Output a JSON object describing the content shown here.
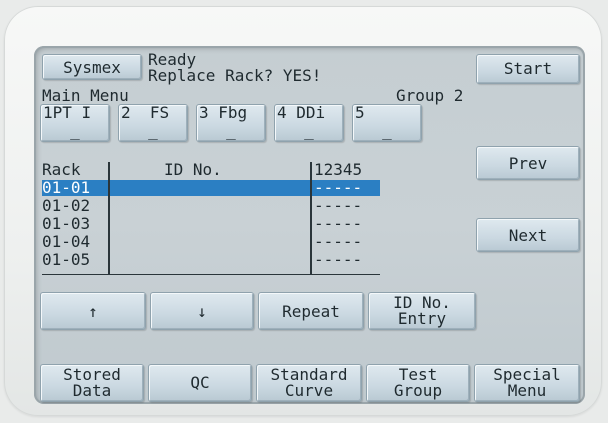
{
  "header": {
    "brand": "Sysmex",
    "status_line1": "Ready",
    "status_line2": "Replace Rack? YES!",
    "start_label": "Start"
  },
  "menu": {
    "title": "Main Menu",
    "group_label": "Group 2",
    "groups": [
      {
        "label": "1PT I",
        "dash": "_"
      },
      {
        "label": "2  FS",
        "dash": "_"
      },
      {
        "label": "3 Fbg",
        "dash": "_"
      },
      {
        "label": "4 DDi",
        "dash": "_"
      },
      {
        "label": "5",
        "dash": "_"
      }
    ]
  },
  "table": {
    "col_rack": "Rack",
    "col_id": "ID No.",
    "col_tests": "12345",
    "rows": [
      {
        "rack": "01-01",
        "id": "",
        "tests": "-----",
        "selected": true
      },
      {
        "rack": "01-02",
        "id": "",
        "tests": "-----"
      },
      {
        "rack": "01-03",
        "id": "",
        "tests": "-----"
      },
      {
        "rack": "01-04",
        "id": "",
        "tests": "-----"
      },
      {
        "rack": "01-05",
        "id": "",
        "tests": "-----"
      }
    ]
  },
  "side": {
    "prev_label": "Prev",
    "next_label": "Next"
  },
  "actions": {
    "up_label": "↑",
    "down_label": "↓",
    "repeat_label": "Repeat",
    "id_entry_line1": "ID No.",
    "id_entry_line2": "Entry"
  },
  "bottom": [
    {
      "line1": "Stored",
      "line2": "Data"
    },
    {
      "line1": "QC",
      "line2": ""
    },
    {
      "line1": "Standard",
      "line2": "Curve"
    },
    {
      "line1": "Test",
      "line2": "Group"
    },
    {
      "line1": "Special",
      "line2": "Menu"
    }
  ],
  "colors": {
    "selection": "#2b7fc3",
    "screen": "#c5ced2",
    "button": "#cad8e1"
  }
}
